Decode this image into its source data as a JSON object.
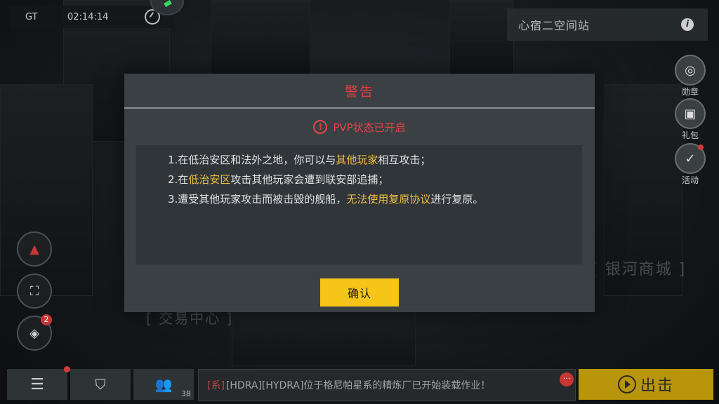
{
  "status": {
    "gt": "GT",
    "time": "02:14:14"
  },
  "location": {
    "name": "心宿二空间站",
    "info_symbol": "i"
  },
  "background_signs": {
    "galaxy_mall": "[ 银河商城 ]",
    "trade_center": "[ 交易中心 ]"
  },
  "side_buttons": [
    {
      "label": "勋章",
      "icon": "medal-icon"
    },
    {
      "label": "礼包",
      "icon": "gift-icon"
    },
    {
      "label": "活动",
      "icon": "event-check-icon"
    }
  ],
  "left_buttons": {
    "map_badge": "2"
  },
  "bottom": {
    "online_count": "38",
    "chat_tag": "[系]",
    "chat_message": "[HDRA][HYDRA]位于格尼帕星系的精炼厂已开始装载作业！",
    "chat_more": "···",
    "launch_label": "出击"
  },
  "modal": {
    "title": "警告",
    "subtitle": "PVP状态已开启",
    "alert_symbol": "!",
    "rules": [
      {
        "prefix": "1.在低治安区和法外之地，你可以与",
        "highlight": "其他玩家",
        "suffix": "相互攻击；"
      },
      {
        "prefix": "2.在",
        "highlight": "低治安区",
        "suffix": "攻击其他玩家会遭到联安部追捕；"
      },
      {
        "prefix": "3.遭受其他玩家攻击而被击毁的舰船，",
        "highlight": "无法使用复原协议",
        "suffix": "进行复原。"
      }
    ],
    "confirm_label": "确认"
  },
  "colors": {
    "warning_red": "#e34040",
    "highlight_yellow": "#f0be3c",
    "confirm_yellow": "#f5c518",
    "launch_gold": "#b9950b"
  }
}
